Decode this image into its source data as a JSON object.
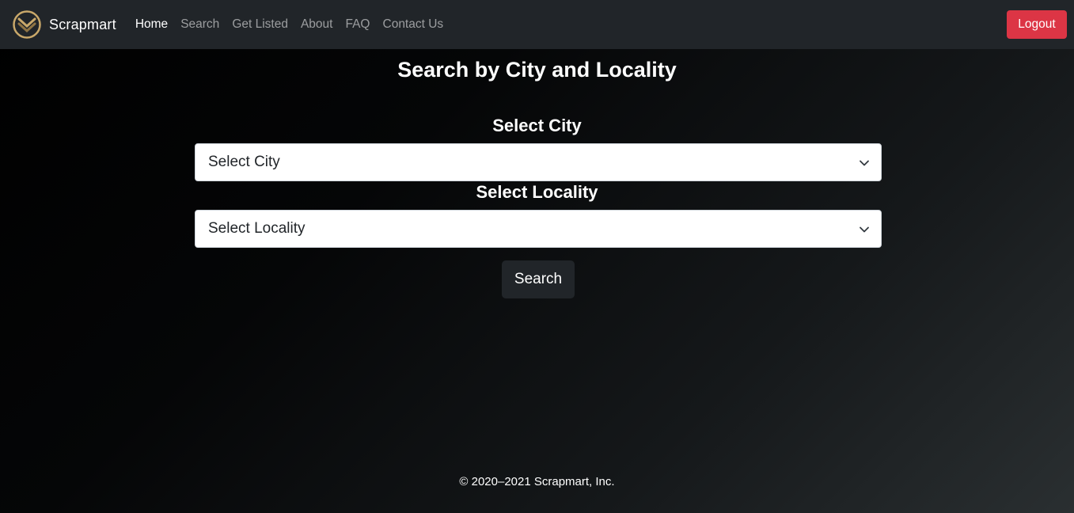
{
  "brand": {
    "name": "Scrapmart",
    "logo_icon": "scrapmart-logo-icon"
  },
  "nav": {
    "items": [
      {
        "label": "Home",
        "active": true
      },
      {
        "label": "Search",
        "active": false
      },
      {
        "label": "Get Listed",
        "active": false
      },
      {
        "label": "About",
        "active": false
      },
      {
        "label": "FAQ",
        "active": false
      },
      {
        "label": "Contact Us",
        "active": false
      }
    ],
    "logout_label": "Logout"
  },
  "main": {
    "title": "Search by City and Locality",
    "city": {
      "label": "Select City",
      "selected": "Select City"
    },
    "locality": {
      "label": "Select Locality",
      "selected": "Select Locality"
    },
    "search_label": "Search"
  },
  "footer": {
    "text": "© 2020–2021 Scrapmart, Inc."
  },
  "colors": {
    "navbar_bg": "#212529",
    "logout_bg": "#dc3545",
    "logo_gold": "#c9a86a",
    "button_dark": "#212529"
  }
}
